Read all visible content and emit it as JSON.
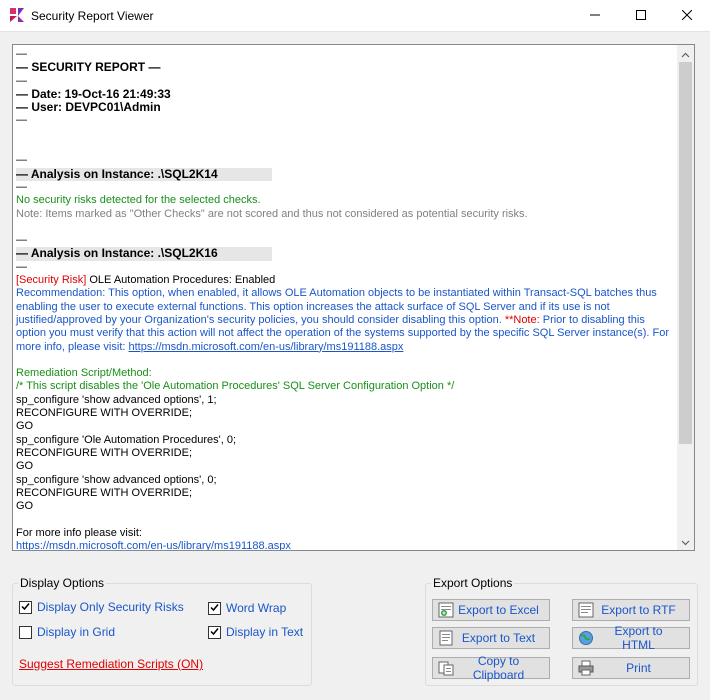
{
  "window": {
    "title": "Security Report Viewer",
    "icons": {
      "app": "app-logo-icon",
      "minimize": "minimize-icon",
      "maximize": "maximize-icon",
      "close": "close-icon"
    }
  },
  "report": {
    "lines": {
      "dash1": "—",
      "header": "— SECURITY REPORT —",
      "dash2": "—",
      "date": "— Date: 19-Oct-16 21:49:33",
      "user": "— User: DEVPC01\\Admin",
      "dash3": "—",
      "dash4": "—",
      "analysis1": "— Analysis on Instance: .\\SQL2K14",
      "dash5": "—",
      "no_risks": "No security risks detected for the selected checks.",
      "note_other": "Note: Items marked as \"Other Checks\" are not scored and thus not considered as potential security risks.",
      "dash6": "—",
      "analysis2": "— Analysis on Instance: .\\SQL2K16",
      "dash7": "—",
      "risk_tag": "[Security Risk]",
      "risk_text": " OLE Automation Procedures: Enabled",
      "rec_part1": "Recommendation: This option, when enabled, it allows OLE Automation objects to be instantiated within Transact-SQL batches thus enabling the user to execute external functions. This option increases the attack surface of SQL Server and if its use is not justified/approved by your Organization's security policies, you should consider disabling this option. ",
      "rec_note_tag": "**Note:",
      "rec_part2": " Prior to disabling this option you must verify that this action will not affect the operation of the systems supported by the specific SQL Server instance(s). For more info, please visit: ",
      "rec_link": "https://msdn.microsoft.com/en-us/library/ms191188.aspx",
      "remediation_title": "Remediation Script/Method:",
      "script_comment": "/* This script disables the 'Ole Automation Procedures' SQL Server Configuration Option */",
      "s1": "sp_configure 'show advanced options', 1;",
      "s2": "RECONFIGURE WITH OVERRIDE;",
      "s3": "GO",
      "s4": "sp_configure 'Ole Automation Procedures', 0;",
      "s5": "RECONFIGURE WITH OVERRIDE;",
      "s6": "GO",
      "s7": "sp_configure 'show advanced options', 0;",
      "s8": "RECONFIGURE WITH OVERRIDE;",
      "s9": "GO",
      "more_info": "For more info please visit:",
      "more_link": "https://msdn.microsoft.com/en-us/library/ms191188.aspx"
    }
  },
  "display_options": {
    "legend": "Display Options",
    "only_risks": {
      "label": "Display Only Security Risks",
      "checked": true
    },
    "grid": {
      "label": "Display in Grid",
      "checked": false
    },
    "word_wrap": {
      "label": "Word Wrap",
      "checked": true
    },
    "text": {
      "label": "Display in Text",
      "checked": true
    },
    "suggest": "Suggest Remediation Scripts (ON)"
  },
  "export_options": {
    "legend": "Export Options",
    "excel": "Export to Excel",
    "rtf": "Export to RTF",
    "text": "Export to Text",
    "html": "Export to HTML",
    "clipboard": "Copy to Clipboard",
    "print": "Print"
  },
  "colors": {
    "accent_blue": "#1a56c9",
    "risk_red": "#e00000",
    "ok_green": "#1a8f1a",
    "note_gray": "#808080"
  }
}
